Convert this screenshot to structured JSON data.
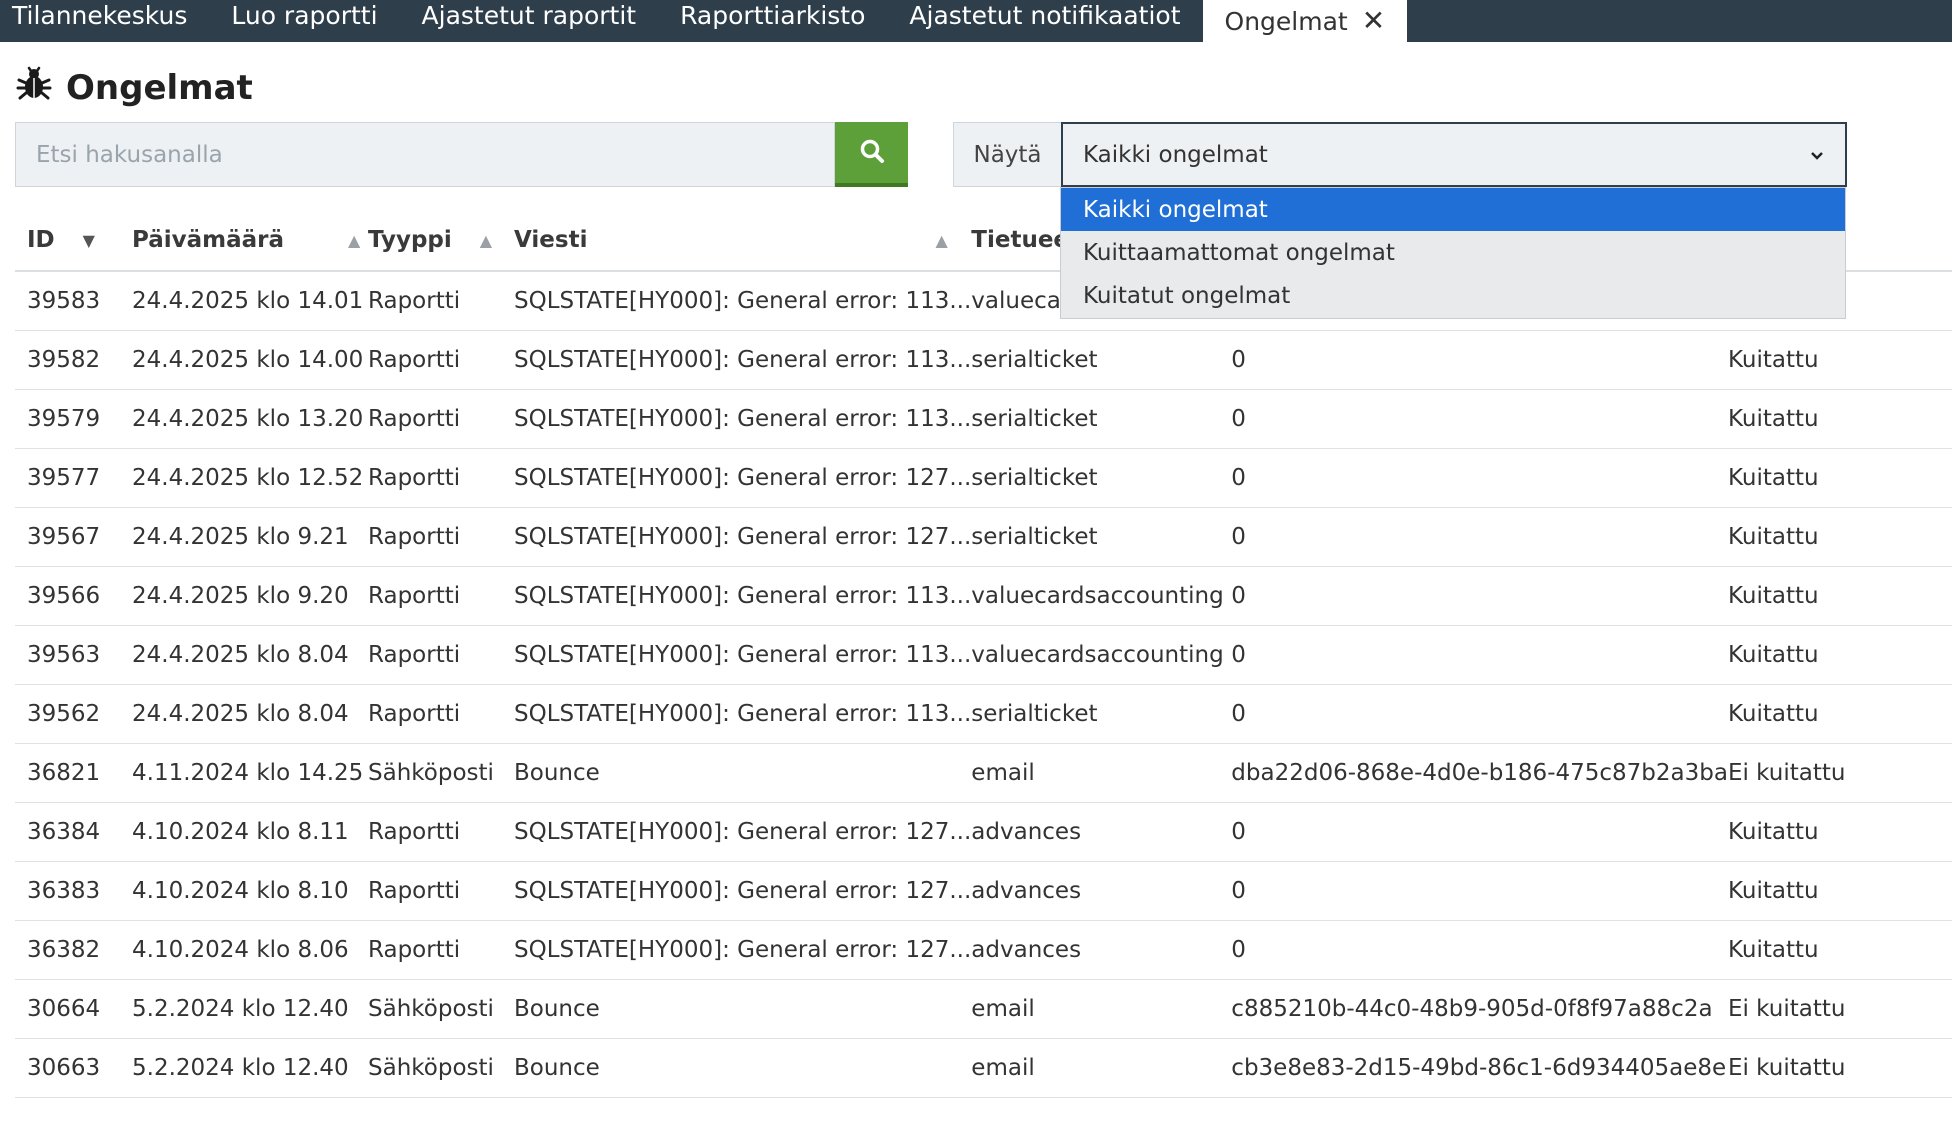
{
  "nav": {
    "tabs": [
      {
        "label": "Tilannekeskus"
      },
      {
        "label": "Luo raportti"
      },
      {
        "label": "Ajastetut raportit"
      },
      {
        "label": "Raporttiarkisto"
      },
      {
        "label": "Ajastetut notifikaatiot"
      }
    ],
    "active_tab": {
      "label": "Ongelmat",
      "close_glyph": "✕"
    }
  },
  "page": {
    "title": "Ongelmat",
    "icon": "bug-icon"
  },
  "search": {
    "placeholder": "Etsi hakusanalla",
    "value": "",
    "button_icon": "search-icon",
    "button_color": "#5da03a"
  },
  "filter": {
    "label": "Näytä",
    "selected": "Kaikki ongelmat",
    "options": [
      "Kaikki ongelmat",
      "Kuittaamattomat ongelmat",
      "Kuitatut ongelmat"
    ]
  },
  "table": {
    "columns": [
      {
        "label": "ID",
        "sort": "desc"
      },
      {
        "label": "Päivämäärä",
        "sort": "asc"
      },
      {
        "label": "Tyyppi",
        "sort": "asc"
      },
      {
        "label": "Viesti",
        "sort": "asc"
      },
      {
        "label": "Tietueen",
        "sort": ""
      },
      {
        "label": "",
        "sort": ""
      },
      {
        "label": "",
        "sort": ""
      }
    ],
    "rows": [
      [
        "39583",
        "24.4.2025 klo 14.01",
        "Raportti",
        "SQLSTATE[HY000]: General error: 113...",
        "valuecard",
        "",
        ""
      ],
      [
        "39582",
        "24.4.2025 klo 14.00",
        "Raportti",
        "SQLSTATE[HY000]: General error: 113...",
        "serialticket",
        "0",
        "Kuitattu"
      ],
      [
        "39579",
        "24.4.2025 klo 13.20",
        "Raportti",
        "SQLSTATE[HY000]: General error: 113...",
        "serialticket",
        "0",
        "Kuitattu"
      ],
      [
        "39577",
        "24.4.2025 klo 12.52",
        "Raportti",
        "SQLSTATE[HY000]: General error: 127...",
        "serialticket",
        "0",
        "Kuitattu"
      ],
      [
        "39567",
        "24.4.2025 klo 9.21",
        "Raportti",
        "SQLSTATE[HY000]: General error: 127...",
        "serialticket",
        "0",
        "Kuitattu"
      ],
      [
        "39566",
        "24.4.2025 klo 9.20",
        "Raportti",
        "SQLSTATE[HY000]: General error: 113...",
        "valuecardsaccounting",
        "0",
        "Kuitattu"
      ],
      [
        "39563",
        "24.4.2025 klo 8.04",
        "Raportti",
        "SQLSTATE[HY000]: General error: 113...",
        "valuecardsaccounting",
        "0",
        "Kuitattu"
      ],
      [
        "39562",
        "24.4.2025 klo 8.04",
        "Raportti",
        "SQLSTATE[HY000]: General error: 113...",
        "serialticket",
        "0",
        "Kuitattu"
      ],
      [
        "36821",
        "4.11.2024 klo 14.25",
        "Sähköposti",
        "Bounce",
        "email",
        "dba22d06-868e-4d0e-b186-475c87b2a3ba",
        "Ei kuitattu"
      ],
      [
        "36384",
        "4.10.2024 klo 8.11",
        "Raportti",
        "SQLSTATE[HY000]: General error: 127...",
        "advances",
        "0",
        "Kuitattu"
      ],
      [
        "36383",
        "4.10.2024 klo 8.10",
        "Raportti",
        "SQLSTATE[HY000]: General error: 127...",
        "advances",
        "0",
        "Kuitattu"
      ],
      [
        "36382",
        "4.10.2024 klo 8.06",
        "Raportti",
        "SQLSTATE[HY000]: General error: 127...",
        "advances",
        "0",
        "Kuitattu"
      ],
      [
        "30664",
        "5.2.2024 klo 12.40",
        "Sähköposti",
        "Bounce",
        "email",
        "c885210b-44c0-48b9-905d-0f8f97a88c2a",
        "Ei kuitattu"
      ],
      [
        "30663",
        "5.2.2024 klo 12.40",
        "Sähköposti",
        "Bounce",
        "email",
        "cb3e8e83-2d15-49bd-86c1-6d934405ae8e",
        "Ei kuitattu"
      ]
    ]
  },
  "colors": {
    "nav_bg": "#2e3e4b",
    "accent_blue": "#1f6fd6",
    "search_green": "#5da03a"
  }
}
